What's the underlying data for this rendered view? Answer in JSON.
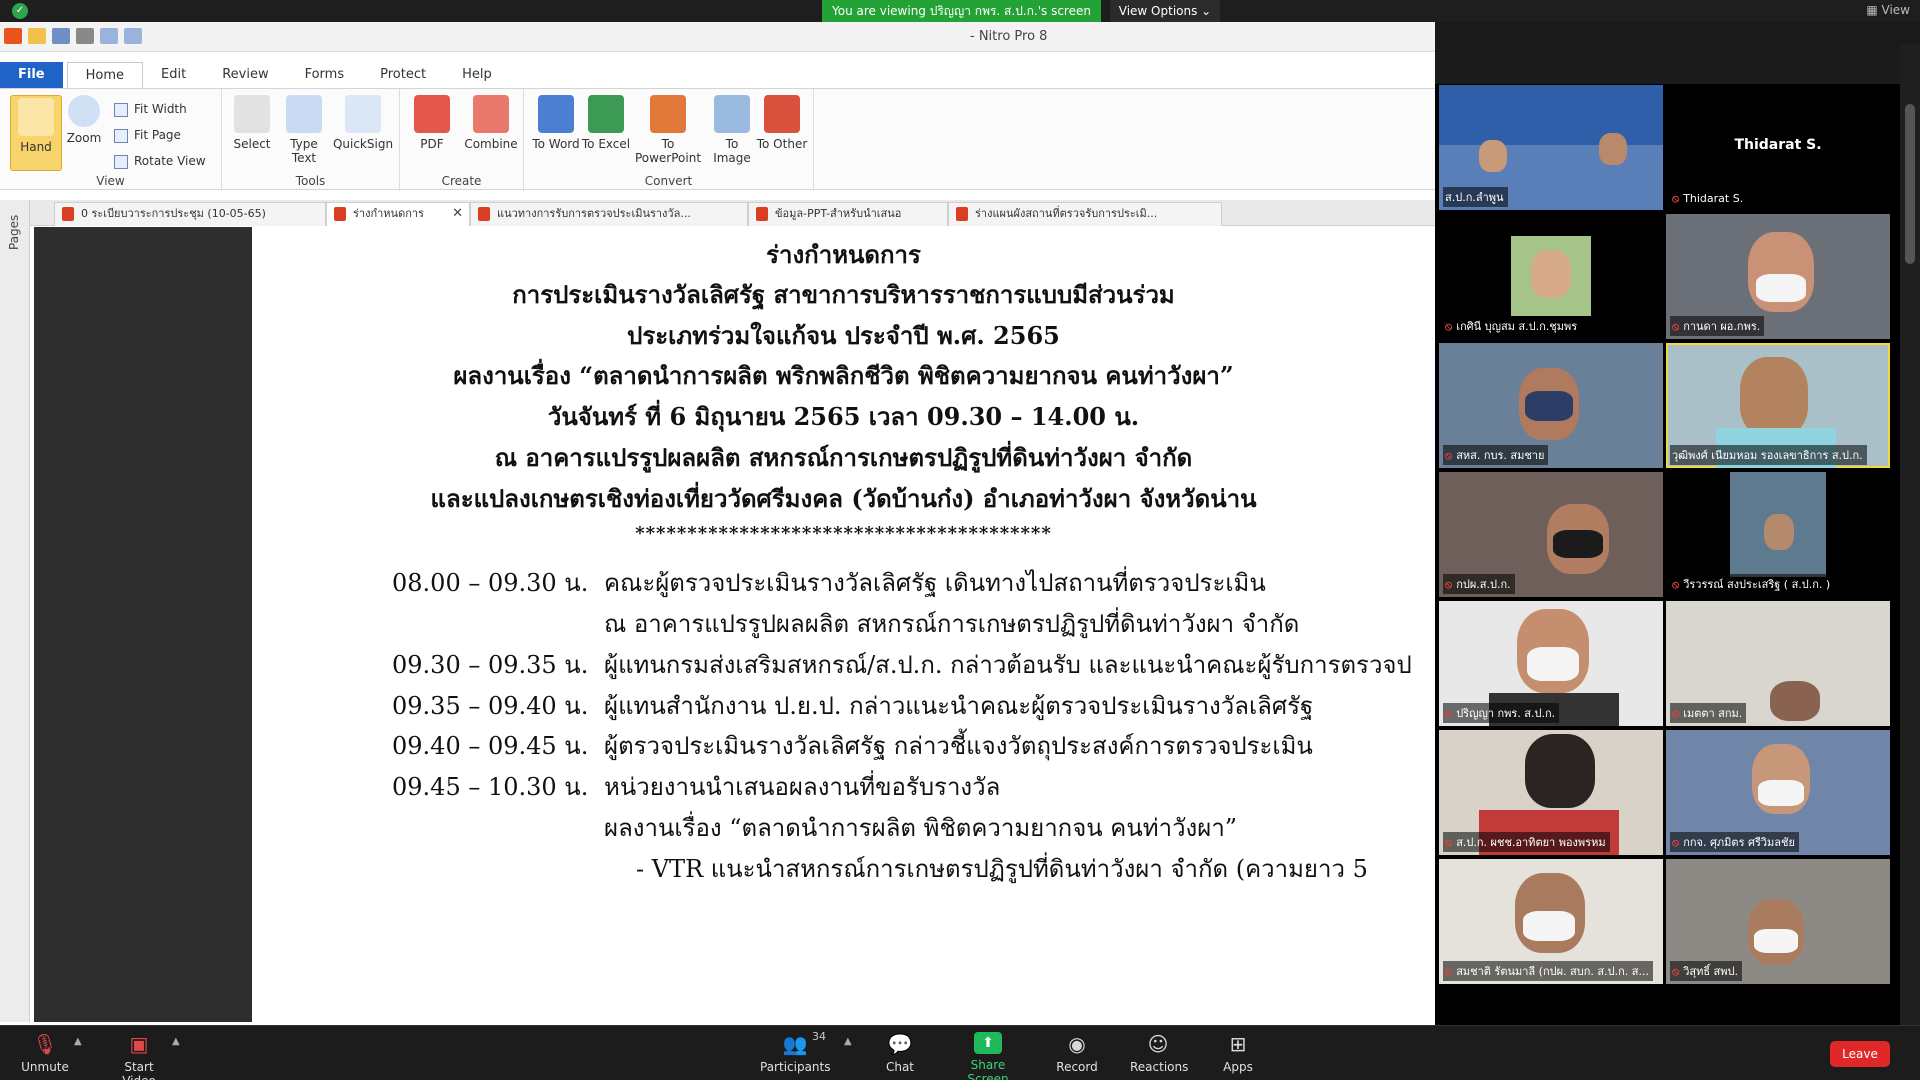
{
  "zoom_top": {
    "banner": "You are viewing ปริญญา กพร. ส.ป.ก.'s screen",
    "view_options": "View Options",
    "view_right": "View"
  },
  "nitro": {
    "title": "- Nitro Pro 8",
    "menu": [
      "File",
      "Home",
      "Edit",
      "Review",
      "Forms",
      "Protect",
      "Help"
    ],
    "ribbon": {
      "view_group": "View",
      "tools_group": "Tools",
      "create_group": "Create",
      "convert_group": "Convert",
      "hand": "Hand",
      "zoom": "Zoom",
      "fit_width": "Fit Width",
      "fit_page": "Fit Page",
      "rotate_view": "Rotate View",
      "select": "Select",
      "type_text": "Type Text",
      "quicksign": "QuickSign",
      "pdf": "PDF",
      "combine": "Combine",
      "to_word": "To Word",
      "to_excel": "To Excel",
      "to_powerpoint": "To PowerPoint",
      "to_image": "To Image",
      "to_other": "To Other"
    },
    "doc_tabs": [
      "0 ระเบียบวาระการประชุม (10-05-65)",
      "ร่างกำหนดการ",
      "แนวทางการรับการตรวจประเมินรางวัล...",
      "ข้อมูล-PPT-สำหรับนำเสนอ",
      "ร่างแผนผังสถานที่ตรวจรับการประเมิ..."
    ],
    "pages_label": "Pages"
  },
  "document": {
    "heading_lines": [
      "ร่างกำหนดการ",
      "การประเมินรางวัลเลิศรัฐ สาขาการบริหารราชการแบบมีส่วนร่วม",
      "ประเภทร่วมใจแก้จน ประจำปี พ.ศ. 2565",
      "ผลงานเรื่อง “ตลาดนำการผลิต พริกพลิกชีวิต พิชิตความยากจน คนท่าวังผา”",
      "วันจันทร์ ที่ 6 มิถุนายน 2565 เวลา 09.30 – 14.00 น.",
      "ณ อาคารแปรรูปผลผลิต สหกรณ์การเกษตรปฏิรูปที่ดินท่าวังผา จำกัด",
      "และแปลงเกษตรเชิงท่องเที่ยววัดศรีมงคล (วัดบ้านก๋ง) อำเภอท่าวังผา จังหวัดน่าน"
    ],
    "separator": "****************************************",
    "schedule": [
      {
        "time": "08.00 – 09.30 น.",
        "text": "คณะผู้ตรวจประเมินรางวัลเลิศรัฐ เดินทางไปสถานที่ตรวจประเมิน"
      },
      {
        "time": "",
        "text": "ณ อาคารแปรรูปผลผลิต สหกรณ์การเกษตรปฏิรูปที่ดินท่าวังผา จำกัด"
      },
      {
        "time": "09.30 – 09.35 น.",
        "text": "ผู้แทนกรมส่งเสริมสหกรณ์/ส.ป.ก. กล่าวต้อนรับ และแนะนำคณะผู้รับการตรวจป"
      },
      {
        "time": "09.35 – 09.40 น.",
        "text": "ผู้แทนสำนักงาน ป.ย.ป. กล่าวแนะนำคณะผู้ตรวจประเมินรางวัลเลิศรัฐ"
      },
      {
        "time": "09.40 – 09.45 น.",
        "text": "ผู้ตรวจประเมินรางวัลเลิศรัฐ กล่าวชี้แจงวัตถุประสงค์การตรวจประเมิน"
      },
      {
        "time": "09.45 – 10.30 น.",
        "text": "หน่วยงานนำเสนอผลงานที่ขอรับรางวัล"
      },
      {
        "time": "",
        "text": "ผลงานเรื่อง “ตลาดนำการผลิต พิชิตความยากจน คนท่าวังผา”"
      },
      {
        "time": "",
        "text": "- VTR แนะนำสหกรณ์การเกษตรปฏิรูปที่ดินท่าวังผา จำกัด (ความยาว 5"
      }
    ]
  },
  "gallery": {
    "participants": [
      "ส.ป.ก.ลำพูน",
      "Thidarat S.",
      "เกศินี บุญสม ส.ป.ก.ชุมพร",
      "กานดา ผอ.กพร.",
      "สหส. กบร. สมชาย",
      "วุฒิพงศ์ เนียมหอม รองเลขาธิการ ส.ป.ก.",
      "กปผ.ส.ป.ก.",
      "วีรวรรณ์ สงประเสริฐ ( ส.ป.ก. )",
      "ปริญญา กพร. ส.ป.ก.",
      "เมตตา สกม.",
      "ส.ป.ก. ผชช.อาทิตยา พองพรหม",
      "กกจ. ศุภมิตร ศรีวิมลชัย",
      "สมชาติ รัตนมาลี (กปผ. สบก. ส.ป.ก. ส...",
      "วิสุทธิ์ สพป."
    ],
    "center_name": "Thidarat S."
  },
  "toolbar": {
    "unmute": "Unmute",
    "start_video": "Start Video",
    "participants": "Participants",
    "participant_count": "34",
    "chat": "Chat",
    "share_screen": "Share Screen",
    "record": "Record",
    "reactions": "Reactions",
    "apps": "Apps",
    "leave": "Leave"
  },
  "colors": {
    "banner_green": "#23a236",
    "file_tab_blue": "#1f63c6",
    "speaker_outline": "#f0da3b",
    "leave_red": "#e02828"
  }
}
